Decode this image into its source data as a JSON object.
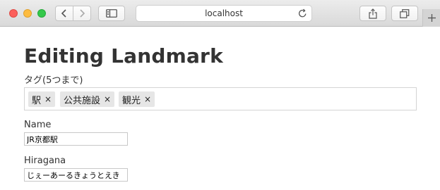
{
  "browser": {
    "url": "localhost",
    "icons": {
      "back": "chevron-left-icon",
      "forward": "chevron-right-icon",
      "sidebar": "sidebar-icon",
      "reload": "reload-icon",
      "share": "share-icon",
      "tabs": "tabs-overview-icon",
      "new_tab": "plus-icon"
    }
  },
  "page": {
    "title": "Editing Landmark",
    "tags": {
      "label": "タグ(5つまで)",
      "items": [
        {
          "text": "駅",
          "remove": "×"
        },
        {
          "text": "公共施設",
          "remove": "×"
        },
        {
          "text": "観光",
          "remove": "×"
        }
      ]
    },
    "name": {
      "label": "Name",
      "value": "JR京都駅"
    },
    "hiragana": {
      "label": "Hiragana",
      "value": "じぇーあーるきょうとえき"
    }
  }
}
